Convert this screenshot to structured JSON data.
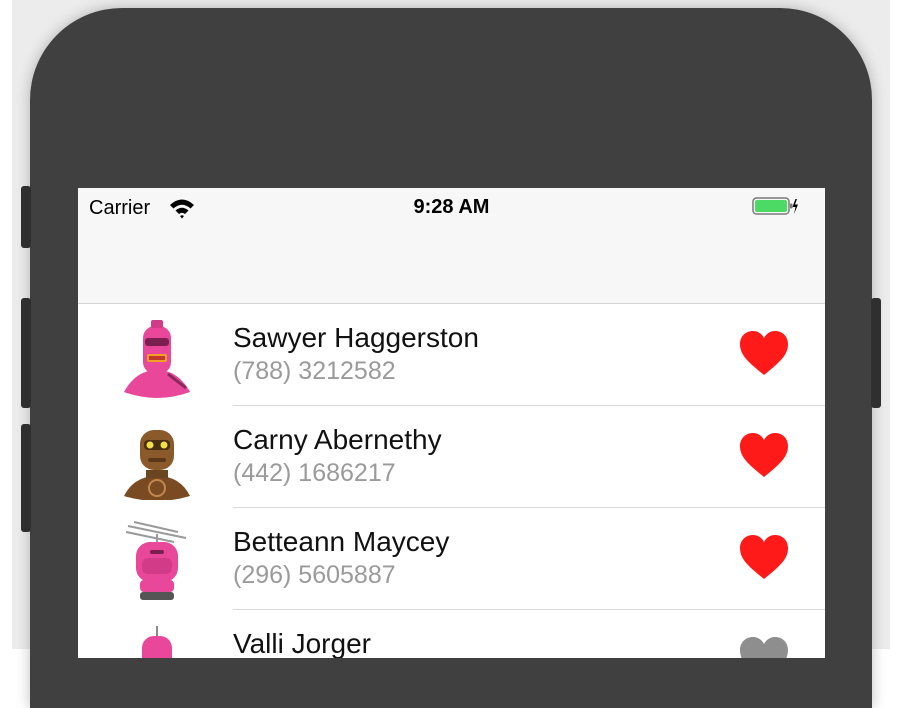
{
  "status_bar": {
    "carrier": "Carrier",
    "time": "9:28 AM",
    "wifi_icon": "wifi-icon",
    "battery_icon": "battery-charging-icon",
    "battery_level": 1.0,
    "battery_color": "#4cd964"
  },
  "colors": {
    "favorite_on": "#ff1a1a",
    "favorite_off": "#8e8e8e",
    "subtitle": "#9a9a9a"
  },
  "contacts": [
    {
      "name": "Sawyer Haggerston",
      "phone": "(788) 3212582",
      "favorite": true
    },
    {
      "name": "Carny Abernethy",
      "phone": "(442) 1686217",
      "favorite": true
    },
    {
      "name": "Betteann Maycey",
      "phone": "(296) 5605887",
      "favorite": true
    },
    {
      "name": "Valli Jorger",
      "phone": "",
      "favorite": false
    }
  ]
}
